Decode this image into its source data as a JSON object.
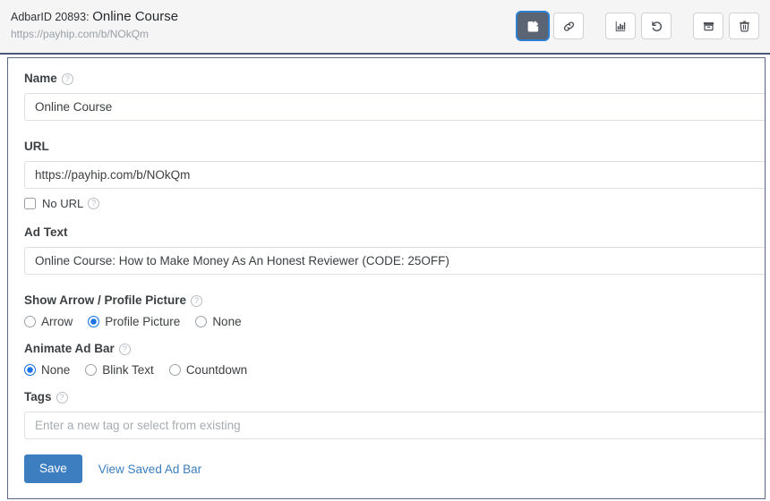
{
  "header": {
    "id_prefix": "AdbarID 20893:",
    "title": "Online Course",
    "url": "https://payhip.com/b/NOkQm"
  },
  "toolbar": {
    "buttons": [
      {
        "name": "edit",
        "title": "Edit",
        "icon": "pencil-square-icon",
        "active": true
      },
      {
        "name": "link",
        "title": "Link",
        "icon": "link-icon",
        "active": false
      },
      {
        "name": "stats",
        "title": "Stats",
        "icon": "bar-chart-icon",
        "active": false
      },
      {
        "name": "revert",
        "title": "Revert",
        "icon": "undo-icon",
        "active": false
      },
      {
        "name": "archive",
        "title": "Archive",
        "icon": "archive-box-icon",
        "active": false
      },
      {
        "name": "delete",
        "title": "Delete",
        "icon": "trash-icon",
        "active": false
      }
    ]
  },
  "form": {
    "name": {
      "label": "Name",
      "help": "?",
      "value": "Online Course"
    },
    "url": {
      "label": "URL",
      "value": "https://payhip.com/b/NOkQm",
      "no_url_label": "No URL",
      "no_url_checked": false,
      "help": "?"
    },
    "ad_text": {
      "label": "Ad Text",
      "value": "Online Course: How to Make Money As An Honest Reviewer (CODE: 25OFF)"
    },
    "show_arrow": {
      "label": "Show Arrow / Profile Picture",
      "help": "?",
      "options": [
        "Arrow",
        "Profile Picture",
        "None"
      ],
      "selected": "Profile Picture"
    },
    "animate": {
      "label": "Animate Ad Bar",
      "help": "?",
      "options": [
        "None",
        "Blink Text",
        "Countdown"
      ],
      "selected": "None"
    },
    "tags": {
      "label": "Tags",
      "help": "?",
      "value": "",
      "placeholder": "Enter a new tag or select from existing"
    }
  },
  "footer": {
    "save_label": "Save",
    "view_link_label": "View Saved Ad Bar"
  },
  "colors": {
    "accent_blue": "#3c7ebf",
    "radio_blue": "#1b73e8",
    "panel_border": "#5b6a8c",
    "header_bg": "#f5f5f6",
    "active_btn_bg": "#5a6472",
    "focus_ring": "#2f7fd1"
  }
}
